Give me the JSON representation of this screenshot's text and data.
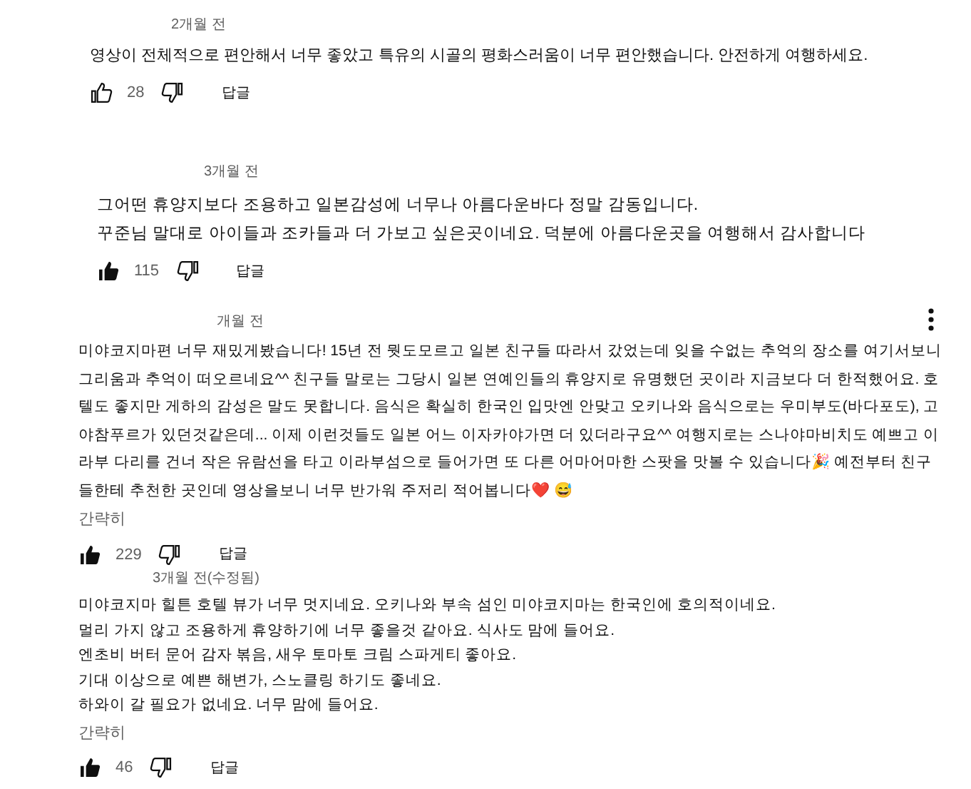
{
  "comments": [
    {
      "time": "2개월 전",
      "body": "영상이 전체적으로 편안해서 너무 좋았고 특유의 시골의 평화스러움이 너무 편안했습니다. 안전하게 여행하세요.",
      "liked": false,
      "likes": "28",
      "reply": "답글"
    },
    {
      "time": "3개월 전",
      "body": "그어떤 휴양지보다 조용하고 일본감성에 너무나 아름다운바다 정말 감동입니다.\n꾸준님 말대로 아이들과 조카들과 더 가보고 싶은곳이네요. 덕분에 아름다운곳을 여행해서 감사합니다",
      "liked": true,
      "likes": "115",
      "reply": "답글"
    },
    {
      "time": "개월 전",
      "menu": true,
      "body": "미야코지마편 너무 재밌게봤습니다! 15년 전 뭣도모르고 일본 친구들 따라서 갔었는데 잊을 수없는 추억의 장소를 여기서보니 그리움과 추억이 떠오르네요^^ 친구들 말로는 그당시 일본 연예인들의 휴양지로 유명했던 곳이라 지금보다 더 한적했어요. 호텔도 좋지만 게하의 감성은 말도 못합니다. 음식은 확실히 한국인 입맛엔 안맞고 오키나와 음식으로는 우미부도(바다포도), 고야참푸르가 있던것같은데... 이제 이런것들도 일본 어느 이자카야가면 더 있더라구요^^ 여행지로는 스나야마비치도 예쁘고 이라부 다리를 건너 작은 유람선을 타고 이라부섬으로 들어가면 또 다른 어마어마한 스팟을 맛볼 수 있습니다🎉 예전부터 친구들한테 추천한 곳인데 영상을보니 너무 반가워 주저리 적어봅니다❤️ 😅",
      "collapse": "간략히",
      "liked": true,
      "likes": "229",
      "reply": "답글"
    },
    {
      "time": "3개월 전(수정됨)",
      "body": "미야코지마 힐튼 호텔 뷰가 너무 멋지네요. 오키나와 부속 섬인 미야코지마는 한국인에 호의적이네요.\n멀리 가지 않고 조용하게 휴양하기에 너무 좋을것 같아요. 식사도 맘에 들어요.\n엔초비 버터 문어 감자 볶음,  새우 토마토 크림 스파게티 좋아요.\n기대 이상으로 예쁜 해변가, 스노클링 하기도 좋네요.\n하와이 갈 필요가 없네요. 너무 맘에 들어요.",
      "collapse": "간략히",
      "liked": true,
      "likes": "46",
      "reply": "답글"
    }
  ]
}
